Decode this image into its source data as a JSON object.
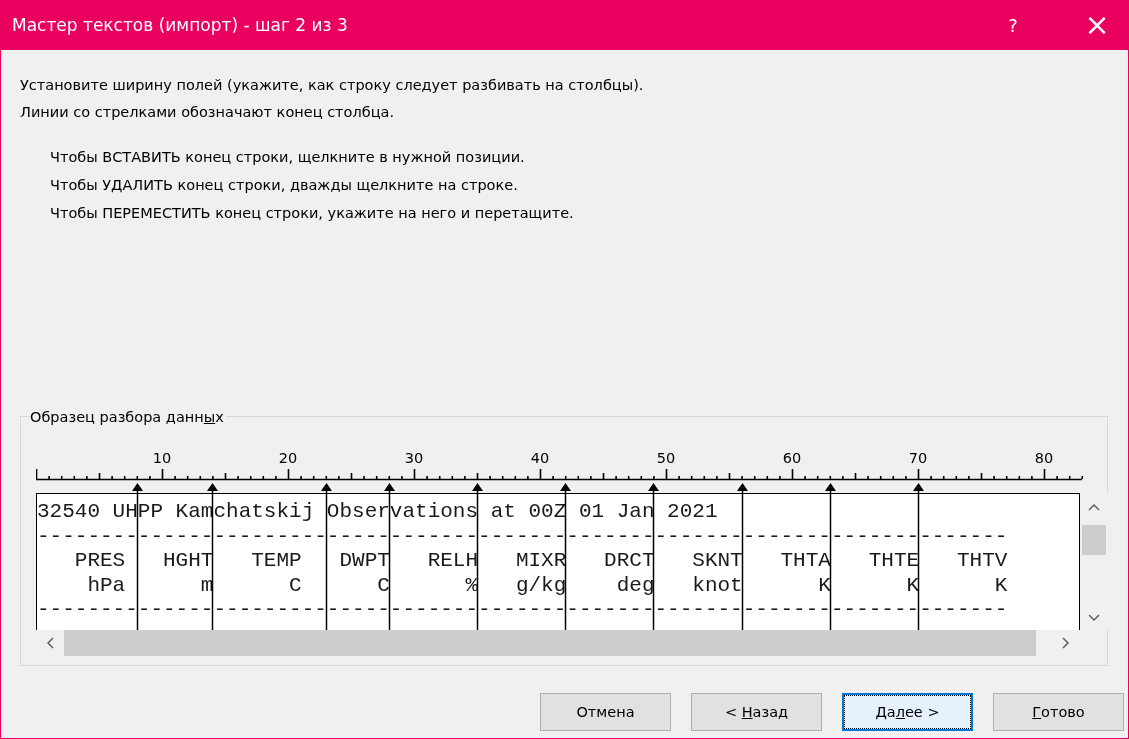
{
  "window": {
    "title": "Мастер текстов (импорт) - шаг 2 из 3",
    "help": "?",
    "close": "×"
  },
  "instructions": [
    "Установите ширину полей (укажите, как строку следует разбивать на столбцы).",
    "Линии со стрелками обозначают конец столбца."
  ],
  "hints": [
    "Чтобы ВСТАВИТЬ конец строки, щелкните в нужной позиции.",
    "Чтобы УДАЛИТЬ конец строки, дважды щелкните на строке.",
    "Чтобы ПЕРЕМЕСТИТЬ конец строки, укажите на него и перетащите."
  ],
  "preview": {
    "label": [
      {
        "text": "Образец разбора данн",
        "access_key": false
      },
      {
        "text": "ы",
        "access_key": true
      },
      {
        "text": "х",
        "access_key": false
      }
    ],
    "ruler": [
      "10",
      "20",
      "30",
      "40",
      "50",
      "60",
      "70",
      "80"
    ],
    "lines": [
      [
        "32540 UH",
        "PP Kam",
        "chatskij ",
        "Obser",
        "vations",
        " at 00Z",
        " 01 Jan",
        " 2021"
      ],
      [
        "-----------------------------------------------------------------------------"
      ],
      [
        "   PRES ",
        "  HGHT",
        "   TEMP  ",
        " DWPT",
        "   RELH",
        "   MIXR",
        "   DRCT",
        "   SKNT",
        "   THTA",
        "   THTE",
        "   THTV"
      ],
      [
        "    hPa ",
        "     m",
        "      C  ",
        "    C",
        "      %",
        "   g/kg",
        "    deg",
        "   knot",
        "      K",
        "      K",
        "      K"
      ],
      [
        "-----------------------------------------------------------------------------"
      ]
    ]
  },
  "buttons": [
    {
      "default": false,
      "parts": [
        {
          "text": "Отмена",
          "access_key": false
        }
      ]
    },
    {
      "default": false,
      "parts": [
        {
          "text": "< ",
          "access_key": false
        },
        {
          "text": "Н",
          "access_key": true
        },
        {
          "text": "азад",
          "access_key": false
        }
      ]
    },
    {
      "default": true,
      "parts": [
        {
          "text": "Да",
          "access_key": false
        },
        {
          "text": "л",
          "access_key": true
        },
        {
          "text": "ее >",
          "access_key": false
        }
      ]
    },
    {
      "default": false,
      "parts": [
        {
          "text": "Г",
          "access_key": true
        },
        {
          "text": "отово",
          "access_key": false
        }
      ]
    }
  ]
}
